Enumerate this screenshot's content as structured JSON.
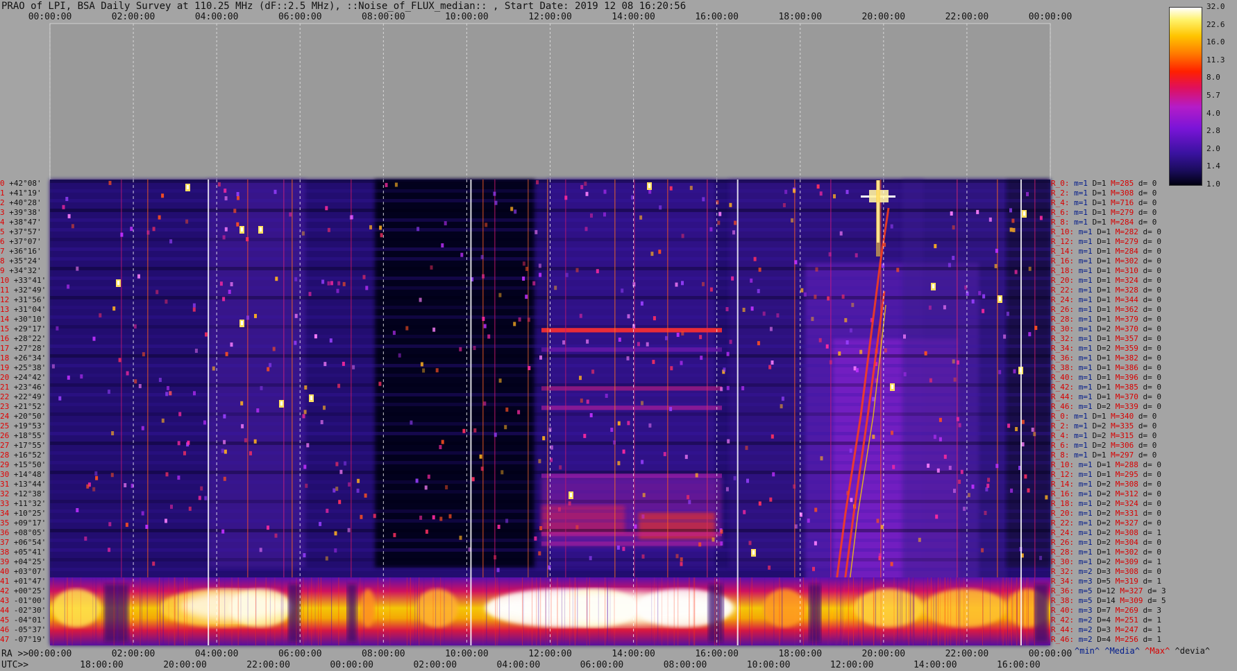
{
  "title": "PRAO of LPI, BSA Daily Survey at 110.25 MHz (dF::2.5 MHz), ::Noise_of_FLUX_median:: , Start Date: 2019 12 08 16:20:56",
  "top_axis_ticks": [
    "00:00:00",
    "02:00:00",
    "04:00:00",
    "06:00:00",
    "08:00:00",
    "10:00:00",
    "12:00:00",
    "14:00:00",
    "16:00:00",
    "18:00:00",
    "20:00:00",
    "22:00:00",
    "00:00:00"
  ],
  "ra_axis": {
    "prefix": "RA >>",
    "ticks": [
      "00:00:00",
      "02:00:00",
      "04:00:00",
      "06:00:00",
      "08:00:00",
      "10:00:00",
      "12:00:00",
      "14:00:00",
      "16:00:00",
      "18:00:00",
      "20:00:00",
      "22:00:00",
      "00:00:00"
    ]
  },
  "utc_axis": {
    "prefix": "UTC>>",
    "ticks": [
      "18:00:00",
      "20:00:00",
      "22:00:00",
      "00:00:00",
      "02:00:00",
      "04:00:00",
      "06:00:00",
      "08:00:00",
      "10:00:00",
      "12:00:00",
      "14:00:00",
      "16:00:00"
    ]
  },
  "dec_rows": [
    {
      "i": "0",
      "d": "+42°08'"
    },
    {
      "i": "1",
      "d": "+41°19'"
    },
    {
      "i": "2",
      "d": "+40°28'"
    },
    {
      "i": "3",
      "d": "+39°38'"
    },
    {
      "i": "4",
      "d": "+38°47'"
    },
    {
      "i": "5",
      "d": "+37°57'"
    },
    {
      "i": "6",
      "d": "+37°07'"
    },
    {
      "i": "7",
      "d": "+36°16'"
    },
    {
      "i": "8",
      "d": "+35°24'"
    },
    {
      "i": "9",
      "d": "+34°32'"
    },
    {
      "i": "10",
      "d": "+33°41'"
    },
    {
      "i": "11",
      "d": "+32°49'"
    },
    {
      "i": "12",
      "d": "+31°56'"
    },
    {
      "i": "13",
      "d": "+31°04'"
    },
    {
      "i": "14",
      "d": "+30°10'"
    },
    {
      "i": "15",
      "d": "+29°17'"
    },
    {
      "i": "16",
      "d": "+28°22'"
    },
    {
      "i": "17",
      "d": "+27°28'"
    },
    {
      "i": "18",
      "d": "+26°34'"
    },
    {
      "i": "19",
      "d": "+25°38'"
    },
    {
      "i": "20",
      "d": "+24°42'"
    },
    {
      "i": "21",
      "d": "+23°46'"
    },
    {
      "i": "22",
      "d": "+22°49'"
    },
    {
      "i": "23",
      "d": "+21°52'"
    },
    {
      "i": "24",
      "d": "+20°50'"
    },
    {
      "i": "25",
      "d": "+19°53'"
    },
    {
      "i": "26",
      "d": "+18°55'"
    },
    {
      "i": "27",
      "d": "+17°55'"
    },
    {
      "i": "28",
      "d": "+16°52'"
    },
    {
      "i": "29",
      "d": "+15°50'"
    },
    {
      "i": "30",
      "d": "+14°48'"
    },
    {
      "i": "31",
      "d": "+13°44'"
    },
    {
      "i": "32",
      "d": "+12°38'"
    },
    {
      "i": "33",
      "d": "+11°32'"
    },
    {
      "i": "34",
      "d": "+10°25'"
    },
    {
      "i": "35",
      "d": "+09°17'"
    },
    {
      "i": "36",
      "d": "+08°05'"
    },
    {
      "i": "37",
      "d": "+06°54'"
    },
    {
      "i": "38",
      "d": "+05°41'"
    },
    {
      "i": "39",
      "d": "+04°25'"
    },
    {
      "i": "40",
      "d": "+03°07'"
    },
    {
      "i": "41",
      "d": "+01°47'"
    },
    {
      "i": "42",
      "d": "+00°25'"
    },
    {
      "i": "43",
      "d": "-01°00'"
    },
    {
      "i": "44",
      "d": "-02°30'"
    },
    {
      "i": "45",
      "d": "-04°01'"
    },
    {
      "i": "46",
      "d": "-05°37'"
    },
    {
      "i": "47",
      "d": "-07°19'"
    }
  ],
  "stats_rows": [
    {
      "r": "R_0:",
      "m": "m=1",
      "D": "D=1",
      "M": "M=285",
      "d": "d= 0"
    },
    {
      "r": "R_2:",
      "m": "m=1",
      "D": "D=1",
      "M": "M=308",
      "d": "d= 0"
    },
    {
      "r": "R_4:",
      "m": "m=1",
      "D": "D=1",
      "M": "M=716",
      "d": "d= 0"
    },
    {
      "r": "R_6:",
      "m": "m=1",
      "D": "D=1",
      "M": "M=279",
      "d": "d= 0"
    },
    {
      "r": "R_8:",
      "m": "m=1",
      "D": "D=1",
      "M": "M=284",
      "d": "d= 0"
    },
    {
      "r": "R_10:",
      "m": "m=1",
      "D": "D=1",
      "M": "M=282",
      "d": "d= 0"
    },
    {
      "r": "R_12:",
      "m": "m=1",
      "D": "D=1",
      "M": "M=279",
      "d": "d= 0"
    },
    {
      "r": "R_14:",
      "m": "m=1",
      "D": "D=1",
      "M": "M=284",
      "d": "d= 0"
    },
    {
      "r": "R_16:",
      "m": "m=1",
      "D": "D=1",
      "M": "M=302",
      "d": "d= 0"
    },
    {
      "r": "R_18:",
      "m": "m=1",
      "D": "D=1",
      "M": "M=310",
      "d": "d= 0"
    },
    {
      "r": "R_20:",
      "m": "m=1",
      "D": "D=1",
      "M": "M=324",
      "d": "d= 0"
    },
    {
      "r": "R_22:",
      "m": "m=1",
      "D": "D=1",
      "M": "M=328",
      "d": "d= 0"
    },
    {
      "r": "R_24:",
      "m": "m=1",
      "D": "D=1",
      "M": "M=344",
      "d": "d= 0"
    },
    {
      "r": "R_26:",
      "m": "m=1",
      "D": "D=1",
      "M": "M=362",
      "d": "d= 0"
    },
    {
      "r": "R_28:",
      "m": "m=1",
      "D": "D=1",
      "M": "M=379",
      "d": "d= 0"
    },
    {
      "r": "R_30:",
      "m": "m=1",
      "D": "D=2",
      "M": "M=370",
      "d": "d= 0"
    },
    {
      "r": "R_32:",
      "m": "m=1",
      "D": "D=1",
      "M": "M=357",
      "d": "d= 0"
    },
    {
      "r": "R_34:",
      "m": "m=1",
      "D": "D=2",
      "M": "M=359",
      "d": "d= 0"
    },
    {
      "r": "R_36:",
      "m": "m=1",
      "D": "D=1",
      "M": "M=382",
      "d": "d= 0"
    },
    {
      "r": "R_38:",
      "m": "m=1",
      "D": "D=1",
      "M": "M=386",
      "d": "d= 0"
    },
    {
      "r": "R_40:",
      "m": "m=1",
      "D": "D=1",
      "M": "M=396",
      "d": "d= 0"
    },
    {
      "r": "R_42:",
      "m": "m=1",
      "D": "D=1",
      "M": "M=385",
      "d": "d= 0"
    },
    {
      "r": "R_44:",
      "m": "m=1",
      "D": "D=1",
      "M": "M=370",
      "d": "d= 0"
    },
    {
      "r": "R_46:",
      "m": "m=1",
      "D": "D=2",
      "M": "M=339",
      "d": "d= 0"
    },
    {
      "r": "R_0:",
      "m": "m=1",
      "D": "D=1",
      "M": "M=340",
      "d": "d= 0"
    },
    {
      "r": "R_2:",
      "m": "m=1",
      "D": "D=2",
      "M": "M=335",
      "d": "d= 0"
    },
    {
      "r": "R_4:",
      "m": "m=1",
      "D": "D=2",
      "M": "M=315",
      "d": "d= 0"
    },
    {
      "r": "R_6:",
      "m": "m=1",
      "D": "D=2",
      "M": "M=306",
      "d": "d= 0"
    },
    {
      "r": "R_8:",
      "m": "m=1",
      "D": "D=1",
      "M": "M=297",
      "d": "d= 0"
    },
    {
      "r": "R_10:",
      "m": "m=1",
      "D": "D=1",
      "M": "M=288",
      "d": "d= 0"
    },
    {
      "r": "R_12:",
      "m": "m=1",
      "D": "D=1",
      "M": "M=295",
      "d": "d= 0"
    },
    {
      "r": "R_14:",
      "m": "m=1",
      "D": "D=2",
      "M": "M=308",
      "d": "d= 0"
    },
    {
      "r": "R_16:",
      "m": "m=1",
      "D": "D=2",
      "M": "M=312",
      "d": "d= 0"
    },
    {
      "r": "R_18:",
      "m": "m=1",
      "D": "D=2",
      "M": "M=324",
      "d": "d= 0"
    },
    {
      "r": "R_20:",
      "m": "m=1",
      "D": "D=2",
      "M": "M=331",
      "d": "d= 0"
    },
    {
      "r": "R_22:",
      "m": "m=1",
      "D": "D=2",
      "M": "M=327",
      "d": "d= 0"
    },
    {
      "r": "R_24:",
      "m": "m=1",
      "D": "D=2",
      "M": "M=308",
      "d": "d= 1"
    },
    {
      "r": "R_26:",
      "m": "m=1",
      "D": "D=2",
      "M": "M=304",
      "d": "d= 0"
    },
    {
      "r": "R_28:",
      "m": "m=1",
      "D": "D=1",
      "M": "M=302",
      "d": "d= 0"
    },
    {
      "r": "R_30:",
      "m": "m=1",
      "D": "D=2",
      "M": "M=309",
      "d": "d= 1"
    },
    {
      "r": "R_32:",
      "m": "m=2",
      "D": "D=3",
      "M": "M=308",
      "d": "d= 0"
    },
    {
      "r": "R_34:",
      "m": "m=3",
      "D": "D=5",
      "M": "M=319",
      "d": "d= 1"
    },
    {
      "r": "R_36:",
      "m": "m=5",
      "D": "D=12",
      "M": "M=327",
      "d": "d= 3"
    },
    {
      "r": "R_38:",
      "m": "m=5",
      "D": "D=14",
      "M": "M=309",
      "d": "d= 5"
    },
    {
      "r": "R_40:",
      "m": "m=3",
      "D": "D=7",
      "M": "M=269",
      "d": "d= 3"
    },
    {
      "r": "R_42:",
      "m": "m=2",
      "D": "D=4",
      "M": "M=251",
      "d": "d= 1"
    },
    {
      "r": "R_44:",
      "m": "m=2",
      "D": "D=3",
      "M": "M=247",
      "d": "d= 1"
    },
    {
      "r": "R_46:",
      "m": "m=2",
      "D": "D=4",
      "M": "M=256",
      "d": "d= 1"
    }
  ],
  "legend_footer": {
    "min": "^min^",
    "media": "^Media^",
    "max": "^Max^",
    "devia": "^devia^"
  },
  "colorbar": {
    "ticks": [
      "32.0",
      "22.6",
      "16.0",
      "11.3",
      "8.0",
      "5.7",
      "4.0",
      "2.8",
      "2.0",
      "1.4",
      "1.0"
    ]
  },
  "chart_data": {
    "type": "heatmap",
    "title": "PRAO of LPI, BSA Daily Survey at 110.25 MHz (dF::2.5 MHz), ::Noise_of_FLUX_median:: , Start Date: 2019 12 08 16:20:56",
    "x_axis_ra": [
      "00:00:00",
      "02:00:00",
      "04:00:00",
      "06:00:00",
      "08:00:00",
      "10:00:00",
      "12:00:00",
      "14:00:00",
      "16:00:00",
      "18:00:00",
      "20:00:00",
      "22:00:00",
      "00:00:00"
    ],
    "x_axis_utc": [
      "18:00:00",
      "20:00:00",
      "22:00:00",
      "00:00:00",
      "02:00:00",
      "04:00:00",
      "06:00:00",
      "08:00:00",
      "10:00:00",
      "12:00:00",
      "14:00:00",
      "16:00:00"
    ],
    "y_axis_dec": [
      "+42°08'",
      "-07°19'"
    ],
    "colorscale_range": [
      1.0,
      32.0
    ],
    "n_rows": 48
  },
  "colors": {
    "background": "#a4a4a4",
    "grid": "#ffffff",
    "label_red": "#d80000",
    "label_blue": "#001a8a"
  }
}
